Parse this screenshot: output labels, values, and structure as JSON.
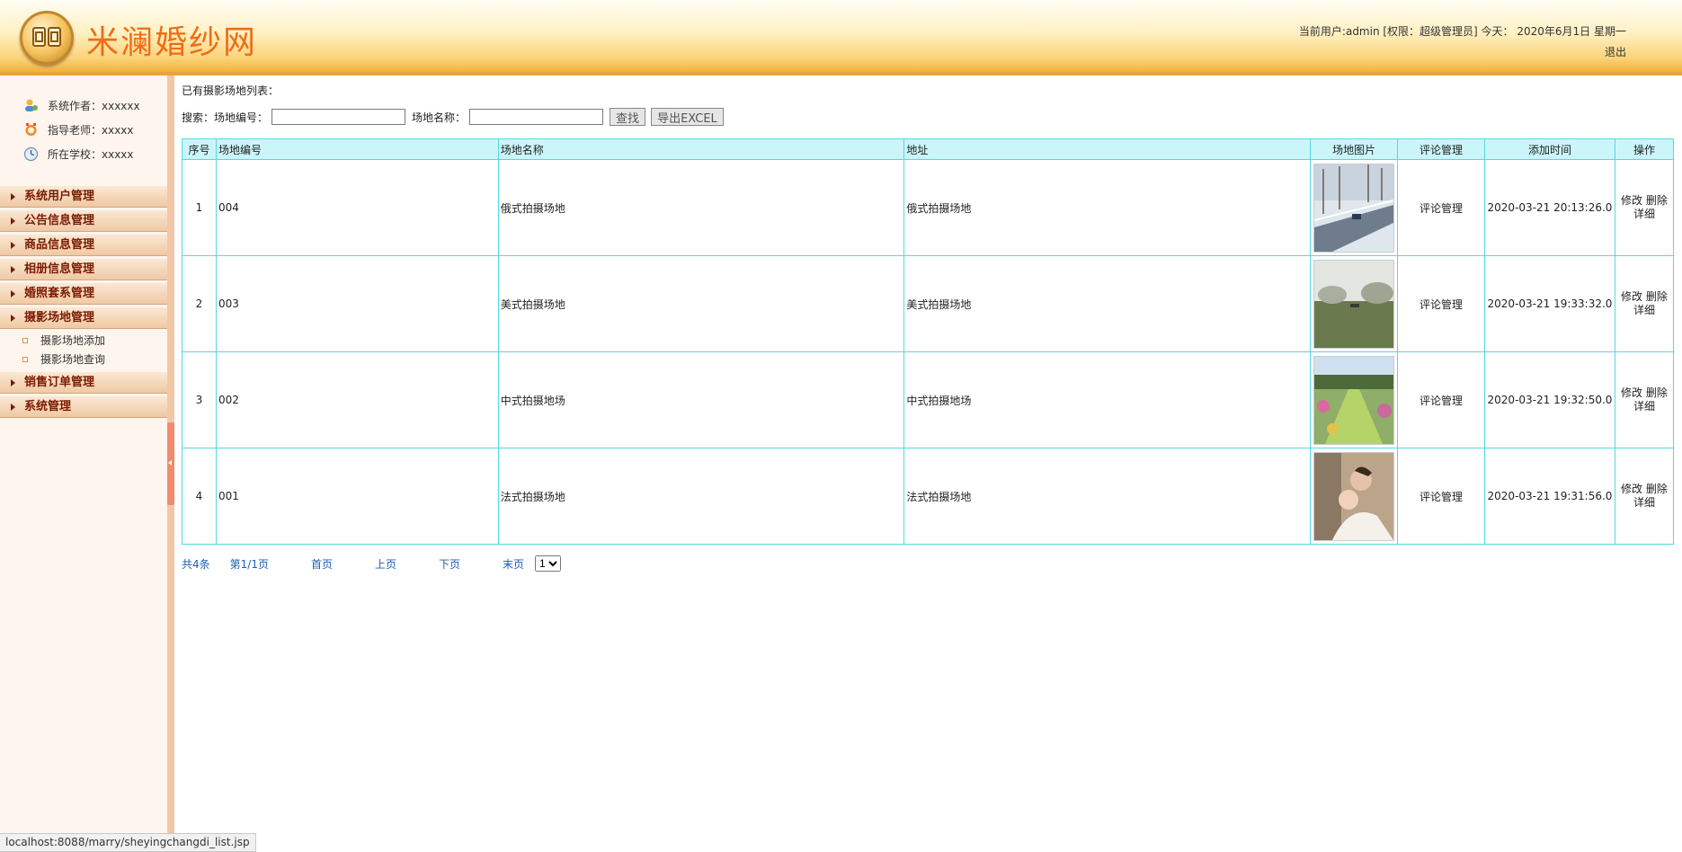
{
  "header": {
    "site_title": "米澜婚纱网",
    "user_info": "当前用户:admin [权限：超级管理员] 今天： 2020年6月1日 星期一",
    "logout": "退出"
  },
  "sidebar": {
    "info": [
      {
        "label": "系统作者：xxxxxx",
        "icon": "author-icon"
      },
      {
        "label": "指导老师：xxxxx",
        "icon": "teacher-icon"
      },
      {
        "label": "所在学校：xxxxx",
        "icon": "school-icon"
      }
    ],
    "menu": [
      {
        "label": "系统用户管理"
      },
      {
        "label": "公告信息管理"
      },
      {
        "label": "商品信息管理"
      },
      {
        "label": "相册信息管理"
      },
      {
        "label": "婚照套系管理"
      },
      {
        "label": "摄影场地管理"
      },
      {
        "label": "销售订单管理"
      },
      {
        "label": "系统管理"
      }
    ],
    "submenu": [
      {
        "label": "摄影场地添加"
      },
      {
        "label": "摄影场地查询"
      }
    ]
  },
  "main": {
    "list_title": "已有摄影场地列表：",
    "search": {
      "label": "搜索：",
      "code_label": "场地编号：",
      "code_value": "",
      "name_label": "场地名称：",
      "name_value": "",
      "find_button": "查找",
      "export_button": "导出EXCEL"
    },
    "table": {
      "headers": [
        "序号",
        "场地编号",
        "场地名称",
        "地址",
        "场地图片",
        "评论管理",
        "添加时间",
        "操作"
      ],
      "rows": [
        {
          "index": "1",
          "code": "004",
          "name": "俄式拍摄场地",
          "address": "俄式拍摄场地",
          "image": "snowy-road-photo",
          "comment": "评论管理",
          "time": "2020-03-21 20:13:26.0",
          "edit": "修改",
          "delete": "删除",
          "detail": "详细"
        },
        {
          "index": "2",
          "code": "003",
          "name": "美式拍摄场地",
          "address": "美式拍摄场地",
          "image": "foggy-field-photo",
          "comment": "评论管理",
          "time": "2020-03-21 19:33:32.0",
          "edit": "修改",
          "delete": "删除",
          "detail": "详细"
        },
        {
          "index": "3",
          "code": "002",
          "name": "中式拍摄地场",
          "address": "中式拍摄地场",
          "image": "garden-path-photo",
          "comment": "评论管理",
          "time": "2020-03-21 19:32:50.0",
          "edit": "修改",
          "delete": "删除",
          "detail": "详细"
        },
        {
          "index": "4",
          "code": "001",
          "name": "法式拍摄场地",
          "address": "法式拍摄场地",
          "image": "couple-photo",
          "comment": "评论管理",
          "time": "2020-03-21 19:31:56.0",
          "edit": "修改",
          "delete": "删除",
          "detail": "详细"
        }
      ]
    },
    "pager": {
      "total": "共4条",
      "page": "第1/1页",
      "first": "首页",
      "prev": "上页",
      "next": "下页",
      "last": "末页",
      "select_value": "1"
    }
  },
  "statusbar": {
    "url": "localhost:8088/marry/sheyingchangdi_list.jsp"
  }
}
